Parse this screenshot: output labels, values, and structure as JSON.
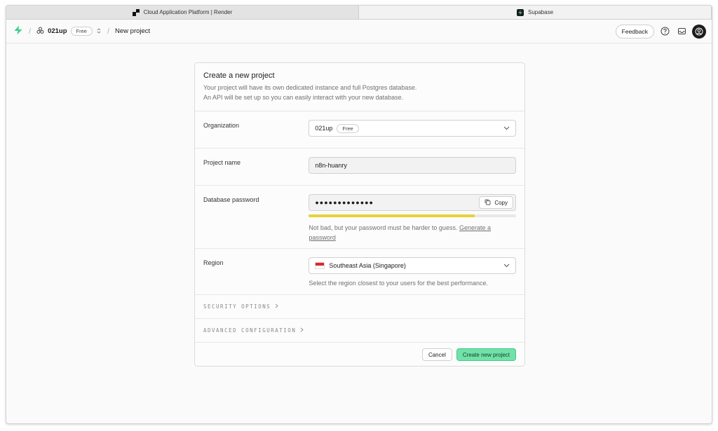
{
  "tabs": [
    {
      "title": "Cloud Application Platform | Render",
      "favicon": "render-logo"
    },
    {
      "title": "Supabase",
      "favicon": "supabase-logo"
    }
  ],
  "header": {
    "org_name": "021up",
    "org_badge": "Free",
    "page": "New project",
    "feedback_label": "Feedback",
    "separator": "/"
  },
  "form": {
    "title": "Create a new project",
    "desc_line1": "Your project will have its own dedicated instance and full Postgres database.",
    "desc_line2": "An API will be set up so you can easily interact with your new database.",
    "organization": {
      "label": "Organization",
      "value": "021up",
      "badge": "Free"
    },
    "project_name": {
      "label": "Project name",
      "value": "n8n-huanry"
    },
    "db_password": {
      "label": "Database password",
      "value": "●●●●●●●●●●●●●",
      "copy_label": "Copy",
      "strength": 0.8,
      "strength_color": "#e6d23b",
      "helper": "Not bad, but your password must be harder to guess.",
      "generate_link": "Generate a password"
    },
    "region": {
      "label": "Region",
      "value": "Southeast Asia (Singapore)",
      "helper": "Select the region closest to your users for the best performance."
    },
    "security_options": "SECURITY OPTIONS",
    "advanced_config": "ADVANCED CONFIGURATION",
    "cancel_label": "Cancel",
    "create_label": "Create new project"
  },
  "colors": {
    "accent": "#3ecf8e",
    "create_button": "#72e1a8"
  }
}
